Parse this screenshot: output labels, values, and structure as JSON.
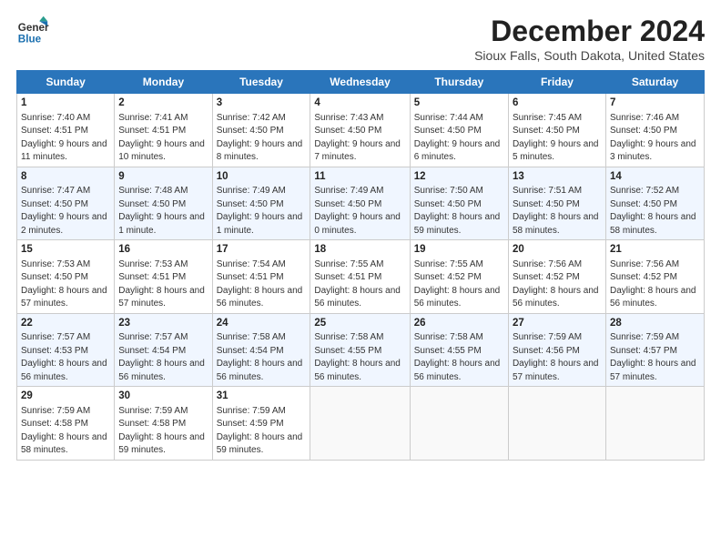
{
  "logo": {
    "line1": "General",
    "line2": "Blue"
  },
  "title": "December 2024",
  "subtitle": "Sioux Falls, South Dakota, United States",
  "days_of_week": [
    "Sunday",
    "Monday",
    "Tuesday",
    "Wednesday",
    "Thursday",
    "Friday",
    "Saturday"
  ],
  "weeks": [
    [
      {
        "day": 1,
        "sunrise": "7:40 AM",
        "sunset": "4:51 PM",
        "daylight": "9 hours and 11 minutes."
      },
      {
        "day": 2,
        "sunrise": "7:41 AM",
        "sunset": "4:51 PM",
        "daylight": "9 hours and 10 minutes."
      },
      {
        "day": 3,
        "sunrise": "7:42 AM",
        "sunset": "4:50 PM",
        "daylight": "9 hours and 8 minutes."
      },
      {
        "day": 4,
        "sunrise": "7:43 AM",
        "sunset": "4:50 PM",
        "daylight": "9 hours and 7 minutes."
      },
      {
        "day": 5,
        "sunrise": "7:44 AM",
        "sunset": "4:50 PM",
        "daylight": "9 hours and 6 minutes."
      },
      {
        "day": 6,
        "sunrise": "7:45 AM",
        "sunset": "4:50 PM",
        "daylight": "9 hours and 5 minutes."
      },
      {
        "day": 7,
        "sunrise": "7:46 AM",
        "sunset": "4:50 PM",
        "daylight": "9 hours and 3 minutes."
      }
    ],
    [
      {
        "day": 8,
        "sunrise": "7:47 AM",
        "sunset": "4:50 PM",
        "daylight": "9 hours and 2 minutes."
      },
      {
        "day": 9,
        "sunrise": "7:48 AM",
        "sunset": "4:50 PM",
        "daylight": "9 hours and 1 minute."
      },
      {
        "day": 10,
        "sunrise": "7:49 AM",
        "sunset": "4:50 PM",
        "daylight": "9 hours and 1 minute."
      },
      {
        "day": 11,
        "sunrise": "7:49 AM",
        "sunset": "4:50 PM",
        "daylight": "9 hours and 0 minutes."
      },
      {
        "day": 12,
        "sunrise": "7:50 AM",
        "sunset": "4:50 PM",
        "daylight": "8 hours and 59 minutes."
      },
      {
        "day": 13,
        "sunrise": "7:51 AM",
        "sunset": "4:50 PM",
        "daylight": "8 hours and 58 minutes."
      },
      {
        "day": 14,
        "sunrise": "7:52 AM",
        "sunset": "4:50 PM",
        "daylight": "8 hours and 58 minutes."
      }
    ],
    [
      {
        "day": 15,
        "sunrise": "7:53 AM",
        "sunset": "4:50 PM",
        "daylight": "8 hours and 57 minutes."
      },
      {
        "day": 16,
        "sunrise": "7:53 AM",
        "sunset": "4:51 PM",
        "daylight": "8 hours and 57 minutes."
      },
      {
        "day": 17,
        "sunrise": "7:54 AM",
        "sunset": "4:51 PM",
        "daylight": "8 hours and 56 minutes."
      },
      {
        "day": 18,
        "sunrise": "7:55 AM",
        "sunset": "4:51 PM",
        "daylight": "8 hours and 56 minutes."
      },
      {
        "day": 19,
        "sunrise": "7:55 AM",
        "sunset": "4:52 PM",
        "daylight": "8 hours and 56 minutes."
      },
      {
        "day": 20,
        "sunrise": "7:56 AM",
        "sunset": "4:52 PM",
        "daylight": "8 hours and 56 minutes."
      },
      {
        "day": 21,
        "sunrise": "7:56 AM",
        "sunset": "4:52 PM",
        "daylight": "8 hours and 56 minutes."
      }
    ],
    [
      {
        "day": 22,
        "sunrise": "7:57 AM",
        "sunset": "4:53 PM",
        "daylight": "8 hours and 56 minutes."
      },
      {
        "day": 23,
        "sunrise": "7:57 AM",
        "sunset": "4:54 PM",
        "daylight": "8 hours and 56 minutes."
      },
      {
        "day": 24,
        "sunrise": "7:58 AM",
        "sunset": "4:54 PM",
        "daylight": "8 hours and 56 minutes."
      },
      {
        "day": 25,
        "sunrise": "7:58 AM",
        "sunset": "4:55 PM",
        "daylight": "8 hours and 56 minutes."
      },
      {
        "day": 26,
        "sunrise": "7:58 AM",
        "sunset": "4:55 PM",
        "daylight": "8 hours and 56 minutes."
      },
      {
        "day": 27,
        "sunrise": "7:59 AM",
        "sunset": "4:56 PM",
        "daylight": "8 hours and 57 minutes."
      },
      {
        "day": 28,
        "sunrise": "7:59 AM",
        "sunset": "4:57 PM",
        "daylight": "8 hours and 57 minutes."
      }
    ],
    [
      {
        "day": 29,
        "sunrise": "7:59 AM",
        "sunset": "4:58 PM",
        "daylight": "8 hours and 58 minutes."
      },
      {
        "day": 30,
        "sunrise": "7:59 AM",
        "sunset": "4:58 PM",
        "daylight": "8 hours and 59 minutes."
      },
      {
        "day": 31,
        "sunrise": "7:59 AM",
        "sunset": "4:59 PM",
        "daylight": "8 hours and 59 minutes."
      },
      null,
      null,
      null,
      null
    ]
  ]
}
